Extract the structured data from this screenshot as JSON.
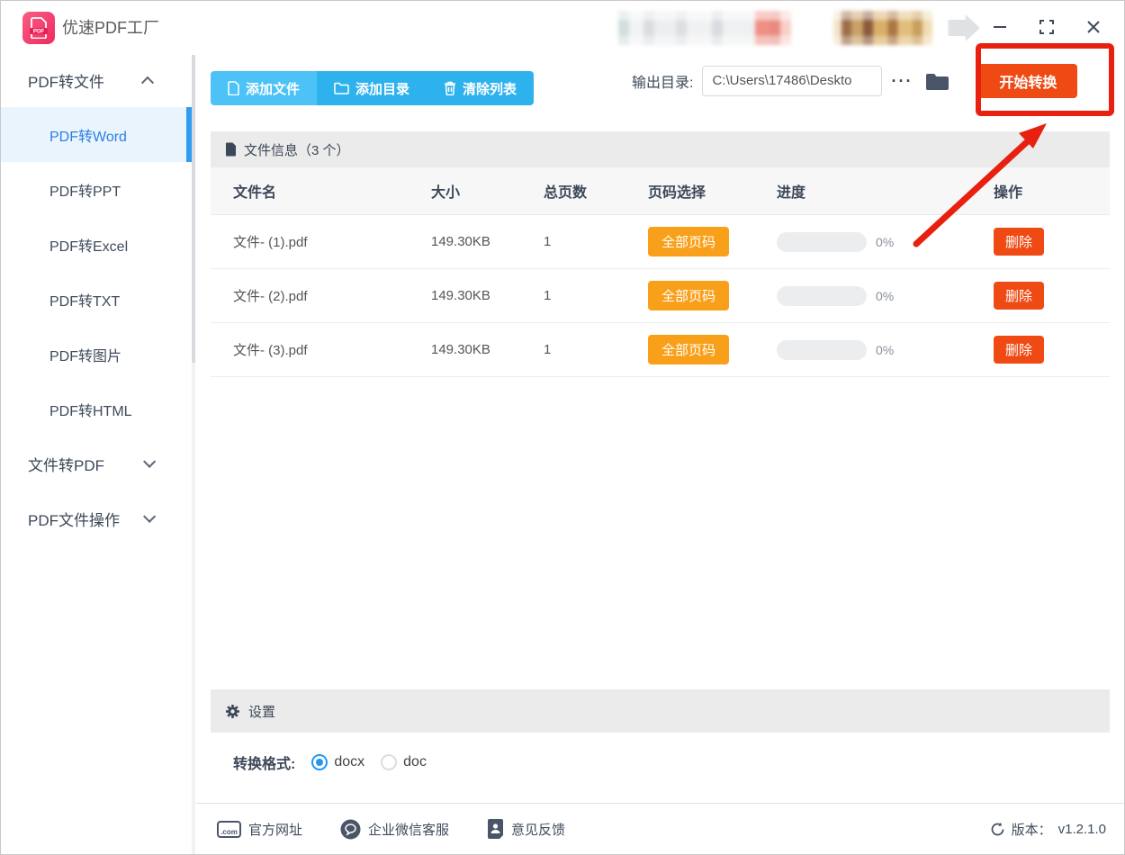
{
  "window": {
    "title": "优速PDF工厂"
  },
  "sidebar": {
    "groups": [
      {
        "label": "PDF转文件"
      },
      {
        "label": "文件转PDF"
      },
      {
        "label": "PDF文件操作"
      }
    ],
    "items": [
      "PDF转Word",
      "PDF转PPT",
      "PDF转Excel",
      "PDF转TXT",
      "PDF转图片",
      "PDF转HTML"
    ],
    "active_item": "PDF转Word"
  },
  "toolbar": {
    "add_file": "添加文件",
    "add_folder": "添加目录",
    "clear_list": "清除列表",
    "output_label": "输出目录:",
    "output_path": "C:\\Users\\17486\\Deskto",
    "more": "···",
    "start": "开始转换"
  },
  "file_info": {
    "label": "文件信息（3 个）"
  },
  "table": {
    "headers": {
      "name": "文件名",
      "size": "大小",
      "pages": "总页数",
      "page_select": "页码选择",
      "progress": "进度",
      "action": "操作"
    },
    "rows": [
      {
        "name": "文件- (1).pdf",
        "size": "149.30KB",
        "pages": "1",
        "page_select": "全部页码",
        "percent": "0%",
        "action": "删除"
      },
      {
        "name": "文件- (2).pdf",
        "size": "149.30KB",
        "pages": "1",
        "page_select": "全部页码",
        "percent": "0%",
        "action": "删除"
      },
      {
        "name": "文件- (3).pdf",
        "size": "149.30KB",
        "pages": "1",
        "page_select": "全部页码",
        "percent": "0%",
        "action": "删除"
      }
    ]
  },
  "settings": {
    "label": "设置",
    "format_label": "转换格式:",
    "options": [
      {
        "label": "docx",
        "selected": true
      },
      {
        "label": "doc",
        "selected": false
      }
    ]
  },
  "footer": {
    "website": "官方网址",
    "website_icon_text": ".com",
    "wechat": "企业微信客服",
    "feedback": "意见反馈",
    "version_label": "版本：",
    "version": "v1.2.1.0"
  },
  "logo_text": "PDF",
  "colors": {
    "accent_blue": "#2eb2ee",
    "accent_orange": "#f9a01b",
    "accent_red": "#f04a14",
    "annotation_red": "#e8200f"
  }
}
